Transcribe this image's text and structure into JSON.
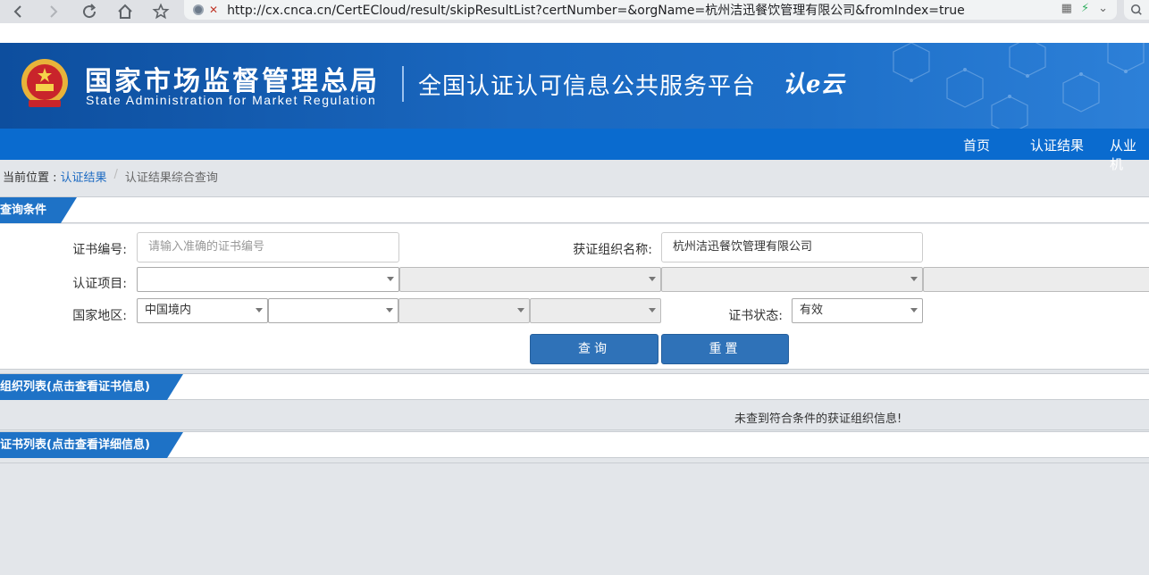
{
  "browser": {
    "url": "http://cx.cnca.cn/CertECloud/result/skipResultList?certNumber=&orgName=杭州洁迅餐饮管理有限公司&fromIndex=true"
  },
  "header": {
    "agency_cn": "国家市场监督管理总局",
    "agency_en": "State Administration  for  Market Regulation",
    "platform": "全国认证认可信息公共服务平台",
    "logo_text": "认e云"
  },
  "nav": {
    "items": [
      "首页",
      "认证结果",
      "从业机"
    ]
  },
  "breadcrumb": {
    "prefix": "当前位置 :",
    "link": "认证结果",
    "separator": "/",
    "current": "认证结果综合查询"
  },
  "query_panel": {
    "title": "查询条件",
    "cert_number_label": "证书编号:",
    "cert_number_placeholder": "请输入准确的证书编号",
    "org_name_label": "获证组织名称:",
    "org_name_value": "杭州洁迅餐饮管理有限公司",
    "cert_project_label": "认证项目:",
    "region_label": "国家地区:",
    "region_value": "中国境内",
    "cert_status_label": "证书状态:",
    "cert_status_value": "有效",
    "search_button": "查询",
    "reset_button": "重置"
  },
  "org_list": {
    "title": "组织列表(点击查看证书信息)",
    "empty_message": "未查到符合条件的获证组织信息!"
  },
  "cert_list": {
    "title": "证书列表(点击查看详细信息)"
  },
  "colors": {
    "banner": "#1a68c0",
    "navbar": "#0a6bcf",
    "tab": "#1e72c6",
    "button": "#2f72b8",
    "link": "#1e6bc2"
  }
}
